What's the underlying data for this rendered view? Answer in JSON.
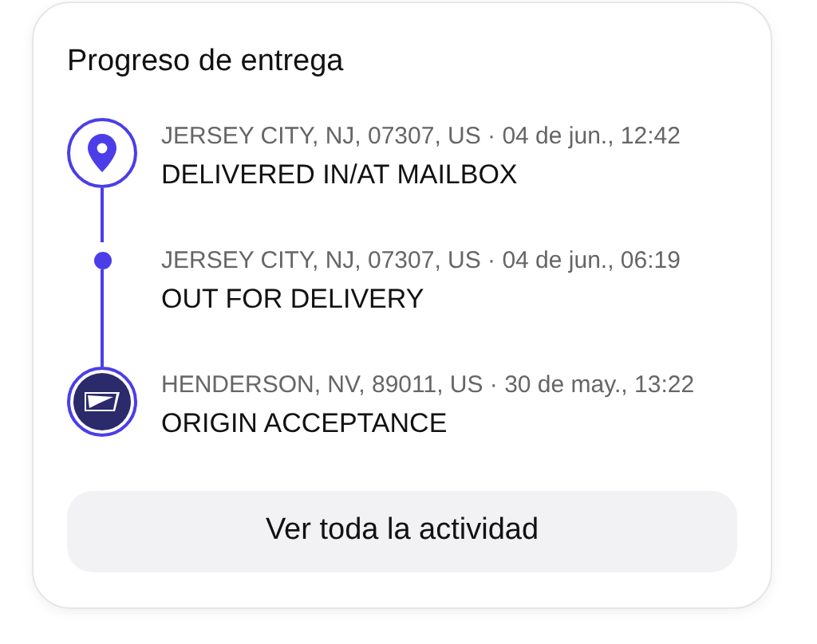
{
  "card": {
    "title": "Progreso de entrega",
    "events": [
      {
        "kind": "pin",
        "meta": "JERSEY CITY, NJ, 07307, US · 04 de jun., 12:42",
        "status": "DELIVERED IN/AT MAILBOX"
      },
      {
        "kind": "dot",
        "meta": "JERSEY CITY, NJ, 07307, US · 04 de jun., 06:19",
        "status": "OUT FOR DELIVERY"
      },
      {
        "kind": "logo",
        "meta": "HENDERSON, NV, 89011, US · 30 de may., 13:22",
        "status": "ORIGIN ACCEPTANCE"
      }
    ],
    "button": "Ver toda la actividad"
  }
}
